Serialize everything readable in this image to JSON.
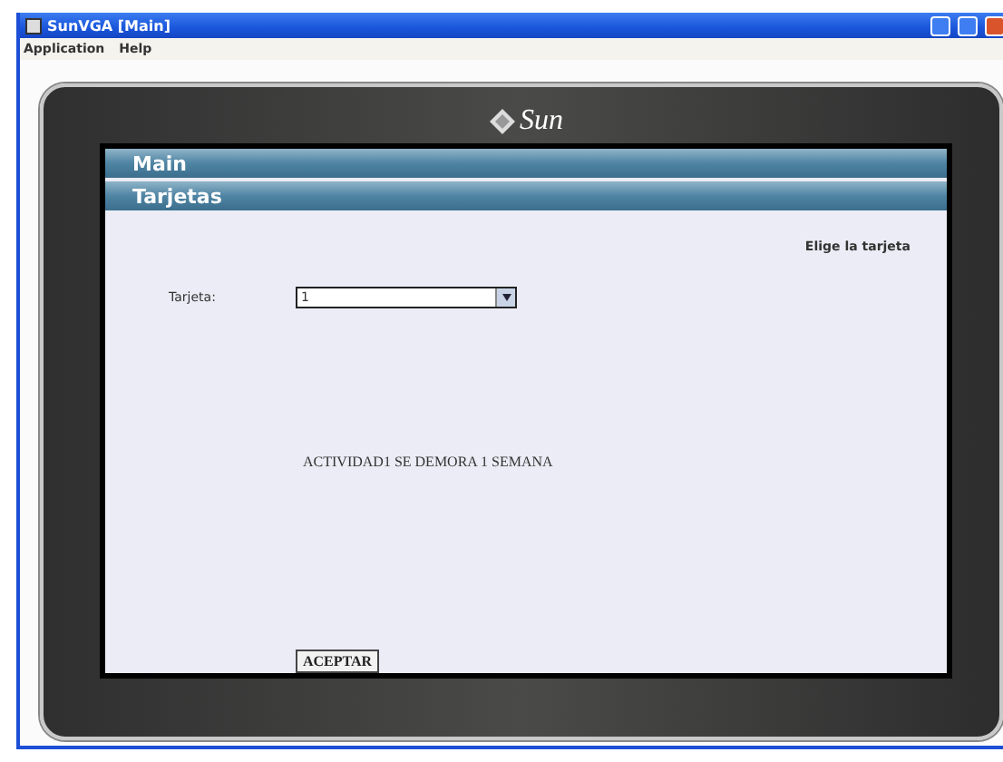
{
  "window": {
    "title": "SunVGA [Main]"
  },
  "menu": [
    "Application",
    "Help"
  ],
  "brand": {
    "name": "Sun"
  },
  "bars": [
    {
      "label": "Main"
    },
    {
      "label": "Tarjetas"
    }
  ],
  "form": {
    "heading": "Elige la tarjeta",
    "field_label": "Tarjeta:",
    "select_value": "1",
    "message": "ACTIVIDAD1 SE DEMORA 1 SEMANA",
    "button": "ACEPTAR"
  }
}
